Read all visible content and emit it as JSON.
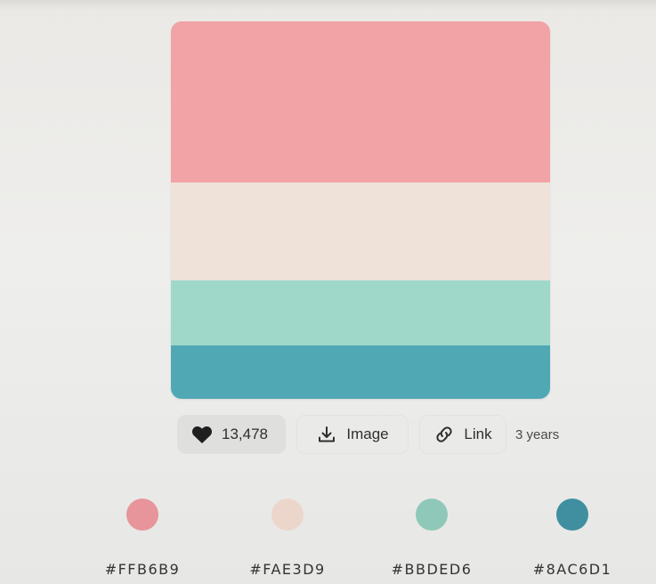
{
  "palette": {
    "colors": [
      "#FFB6B9",
      "#FAE3D9",
      "#BBDED6",
      "#8AC6D1"
    ],
    "display_colors": [
      "#f1a3a5",
      "#efe2d8",
      "#9fd8c9",
      "#50a8b5"
    ]
  },
  "actions": {
    "likes": "13,478",
    "image_label": "Image",
    "link_label": "Link",
    "age": "3 years"
  },
  "swatches": [
    {
      "hex": "#FFB6B9",
      "display": "#e7949a"
    },
    {
      "hex": "#FAE3D9",
      "display": "#ecd6cc"
    },
    {
      "hex": "#BBDED6",
      "display": "#8fc8b9"
    },
    {
      "hex": "#8AC6D1",
      "display": "#3f8fa0"
    }
  ],
  "icons": {
    "like": "heart-icon",
    "image": "download-icon",
    "link": "link-icon"
  }
}
